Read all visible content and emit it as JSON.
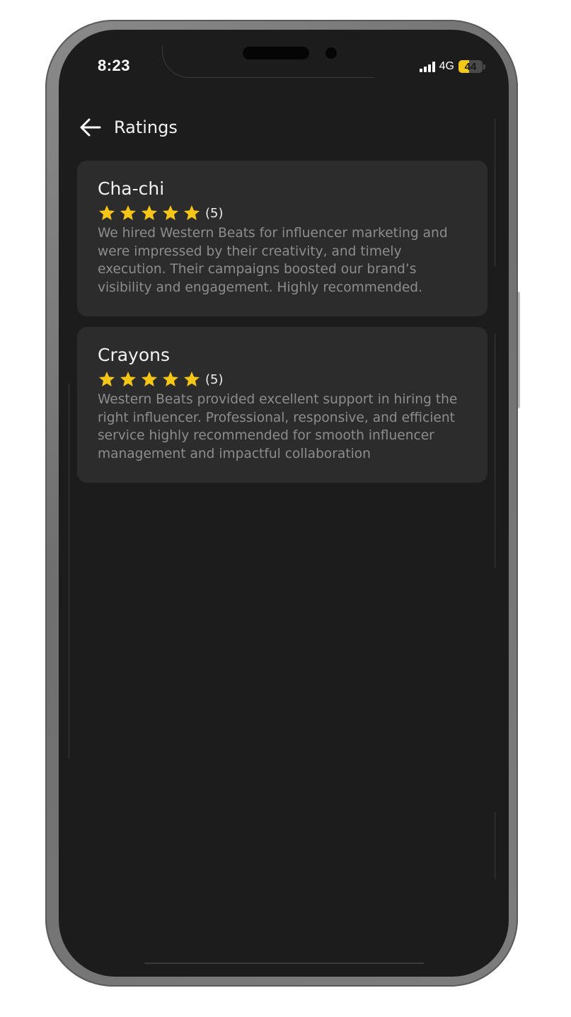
{
  "status_bar": {
    "time": "8:23",
    "network": "4G",
    "battery_level": "44",
    "battery_fraction": 0.44,
    "signal_icon": "signal-bars-icon"
  },
  "header": {
    "back_icon": "arrow-left-icon",
    "title": "Ratings"
  },
  "reviews": [
    {
      "name": "Cha-chi",
      "stars": 5,
      "rating_label": "(5)",
      "text": "We hired Western Beats for influencer marketing and were impressed by their creativity, and timely execution. Their campaigns boosted our brand’s visibility and engagement. Highly recommended."
    },
    {
      "name": "Crayons",
      "stars": 5,
      "rating_label": "(5)",
      "text": "Western Beats provided excellent support in hiring the right influencer. Professional, responsive, and efficient service highly recommended for smooth influencer management and impactful collaboration"
    }
  ],
  "colors": {
    "background": "#1c1c1c",
    "card": "#2c2c2c",
    "star": "#f5c518",
    "text_primary": "#f2f2f2",
    "text_secondary": "#8d8d8d",
    "battery_fill": "#f3c817"
  }
}
